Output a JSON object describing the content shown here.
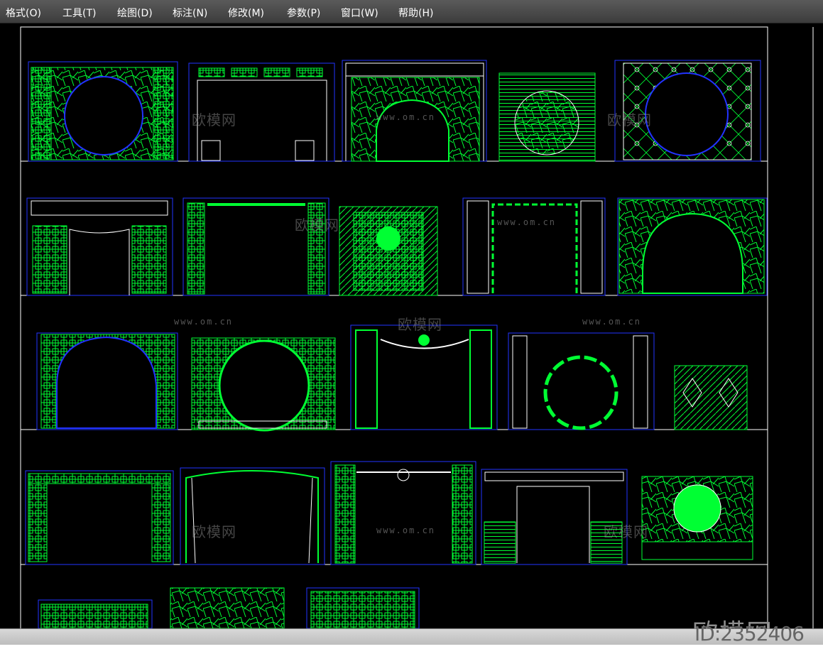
{
  "menu": [
    {
      "label": "格式(O)"
    },
    {
      "label": "工具(T)"
    },
    {
      "label": "绘图(D)"
    },
    {
      "label": "标注(N)"
    },
    {
      "label": "修改(M)"
    },
    {
      "label": "参数(P)"
    },
    {
      "label": "窗口(W)"
    },
    {
      "label": "帮助(H)"
    }
  ],
  "watermark": {
    "site": "www.om.cn",
    "brand": "欧模网",
    "id": "ID:2352406"
  },
  "colors": {
    "background": "#000000",
    "line_green": "#00ff33",
    "line_blue": "#2233ff",
    "frame_white": "#ffffff"
  }
}
